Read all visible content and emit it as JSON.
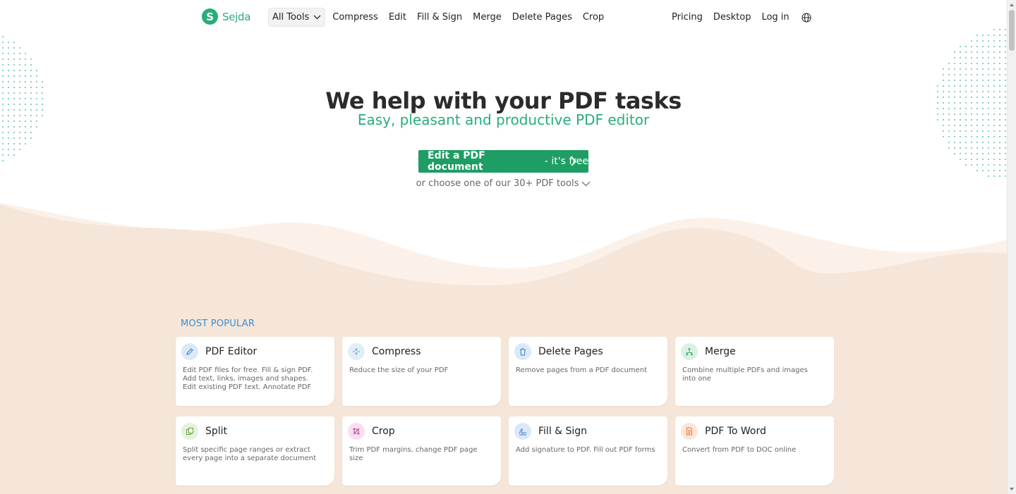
{
  "brand": {
    "name": "Sejda",
    "mark": "S",
    "color": "#27ae78"
  },
  "nav": {
    "all_tools": "All Tools",
    "items": [
      "Compress",
      "Edit",
      "Fill & Sign",
      "Merge",
      "Delete Pages",
      "Crop"
    ],
    "right_items": [
      "Pricing",
      "Desktop",
      "Log in"
    ],
    "language_icon": "globe-icon"
  },
  "hero": {
    "title": "We help with your PDF tasks",
    "subtitle": "Easy, pleasant and productive PDF editor",
    "cta_strong": "Edit a PDF document",
    "cta_rest": " - it's free",
    "choose_text": "or choose one of our 30+ PDF tools"
  },
  "popular": {
    "title": "MOST POPULAR",
    "cards": [
      {
        "name": "PDF Editor",
        "desc": "Edit PDF files for free. Fill & sign PDF. Add text, links, images and shapes. Edit existing PDF text. Annotate PDF",
        "icon": "pencil-icon",
        "icon_bg": "#dbe9f7",
        "icon_color": "#3a7fc4"
      },
      {
        "name": "Compress",
        "desc": "Reduce the size of your PDF",
        "icon": "compress-icon",
        "icon_bg": "#e0eef7",
        "icon_color": "#6aa3c8"
      },
      {
        "name": "Delete Pages",
        "desc": "Remove pages from a PDF document",
        "icon": "trash-icon",
        "icon_bg": "#dbe9f7",
        "icon_color": "#3a7fc4"
      },
      {
        "name": "Merge",
        "desc": "Combine multiple PDFs and images into one",
        "icon": "merge-icon",
        "icon_bg": "#dcf0e4",
        "icon_color": "#3aa76d"
      },
      {
        "name": "Split",
        "desc": "Split specific page ranges or extract every page into a separate document",
        "icon": "split-icon",
        "icon_bg": "#e6f2dc",
        "icon_color": "#5fa03a"
      },
      {
        "name": "Crop",
        "desc": "Trim PDF margins, change PDF page size",
        "icon": "crop-icon",
        "icon_bg": "#f7dff0",
        "icon_color": "#c0479a"
      },
      {
        "name": "Fill & Sign",
        "desc": "Add signature to PDF. Fill out PDF forms",
        "icon": "signature-icon",
        "icon_bg": "#dbe9f7",
        "icon_color": "#3a7fc4"
      },
      {
        "name": "PDF To Word",
        "desc": "Convert from PDF to DOC online",
        "icon": "document-icon",
        "icon_bg": "#fbe6d8",
        "icon_color": "#e07b3a"
      }
    ]
  },
  "colors": {
    "accent": "#1e9d64",
    "beige": "#f5e6d9",
    "section_title": "#3a8fd3"
  }
}
